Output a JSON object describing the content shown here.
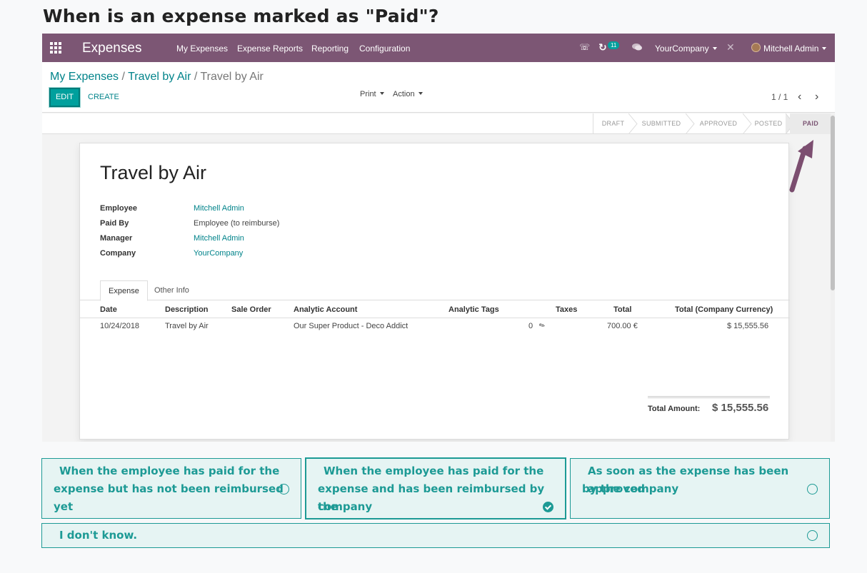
{
  "question": "When is an expense marked as \"Paid\"?",
  "navbar": {
    "app_title": "Expenses",
    "menu": [
      "My Expenses",
      "Expense Reports",
      "Reporting",
      "Configuration"
    ],
    "activity_count": "11",
    "company": "YourCompany",
    "user": "Mitchell Admin",
    "icons": [
      "apps-grid-icon",
      "phone-icon",
      "activity-icon",
      "chat-icon",
      "debug-icon",
      "avatar"
    ]
  },
  "breadcrumb": [
    "My Expenses",
    "Travel by Air",
    "Travel by Air"
  ],
  "breadcrumb_sep": "/",
  "buttons": {
    "edit": "EDIT",
    "create": "CREATE",
    "print": "Print",
    "action": "Action"
  },
  "pager": "1 / 1",
  "stages": [
    "DRAFT",
    "SUBMITTED",
    "APPROVED",
    "POSTED",
    "PAID"
  ],
  "active_stage": "PAID",
  "form": {
    "title": "Travel by Air",
    "fields": [
      {
        "label": "Employee",
        "value": "Mitchell Admin"
      },
      {
        "label": "Paid By",
        "value": "Employee (to reimburse)"
      },
      {
        "label": "Manager",
        "value": "Mitchell Admin"
      },
      {
        "label": "Company",
        "value": "YourCompany"
      }
    ],
    "tabs": [
      "Expense",
      "Other Info"
    ]
  },
  "table": {
    "columns": [
      "Date",
      "Description",
      "Sale Order",
      "Analytic Account",
      "Analytic Tags",
      "Taxes",
      "Total",
      "Total (Company Currency)"
    ],
    "rows": [
      {
        "date": "10/24/2018",
        "description": "Travel by Air",
        "sale_order": "",
        "analytic_account": "Our Super Product - Deco Addict",
        "attachments": "0",
        "total": "700.00 €",
        "total_company": "$ 15,555.56"
      }
    ]
  },
  "total": {
    "label": "Total Amount:",
    "value": "$ 15,555.56"
  },
  "answers": [
    {
      "line1": "When the employee has paid for the",
      "line2": "expense but has not been reimbursed yet",
      "selected": false
    },
    {
      "line1": "When the employee has paid for the",
      "line2": "expense and has been reimbursed by the",
      "line3": "company",
      "selected": true
    },
    {
      "line1": "As soon as the expense has been approved",
      "line2": "by the company",
      "selected": false
    },
    {
      "line1": "I don't know.",
      "selected": false
    }
  ],
  "colors": {
    "brand": "#7c5674",
    "accent": "#00a09d",
    "answer_text": "#1d9a95",
    "answer_bg": "#e6f4f3"
  }
}
